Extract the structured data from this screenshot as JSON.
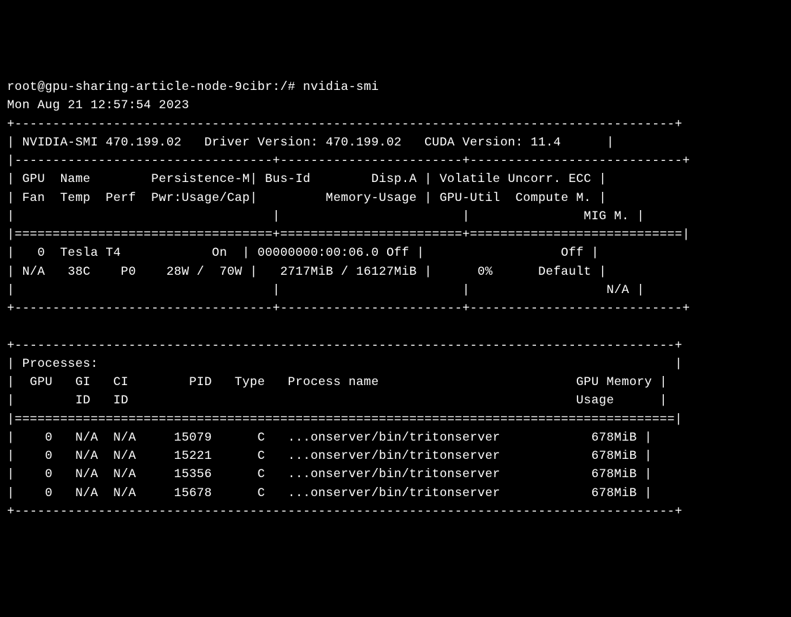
{
  "shell": {
    "prompt": "root@gpu-sharing-article-node-9cibr:/# ",
    "command": "nvidia-smi"
  },
  "header": {
    "timestamp": "Mon Aug 21 12:57:54 2023",
    "top_border": "+---------------------------------------------------------------------------------------+",
    "smi_line": "| NVIDIA-SMI 470.199.02   Driver Version: 470.199.02   CUDA Version: 11.4      |",
    "sep_line": "|----------------------------------+------------------------+----------------------------+",
    "hdr_line1": "| GPU  Name        Persistence-M| Bus-Id        Disp.A | Volatile Uncorr. ECC |",
    "hdr_line2": "| Fan  Temp  Perf  Pwr:Usage/Cap|         Memory-Usage | GPU-Util  Compute M. |",
    "hdr_line3": "|                                  |                        |               MIG M. |",
    "eq_line": "|==================================+========================+============================|",
    "gpu_line1": "|   0  Tesla T4            On  | 00000000:00:06.0 Off |                  Off |",
    "gpu_line2": "| N/A   38C    P0    28W /  70W |   2717MiB / 16127MiB |      0%      Default |",
    "gpu_line3": "|                                  |                        |                  N/A |",
    "bot_border": "+----------------------------------+------------------------+----------------------------+"
  },
  "procs": {
    "top_border": "+---------------------------------------------------------------------------------------+",
    "title": "| Processes:                                                                            |",
    "hdr_line1": "|  GPU   GI   CI        PID   Type   Process name                          GPU Memory |",
    "hdr_line2": "|        ID   ID                                                           Usage      |",
    "eq_line": "|=======================================================================================|",
    "rows": [
      "|    0   N/A  N/A     15079      C   ...onserver/bin/tritonserver            678MiB |",
      "|    0   N/A  N/A     15221      C   ...onserver/bin/tritonserver            678MiB |",
      "|    0   N/A  N/A     15356      C   ...onserver/bin/tritonserver            678MiB |",
      "|    0   N/A  N/A     15678      C   ...onserver/bin/tritonserver            678MiB |"
    ],
    "bot_border": "+---------------------------------------------------------------------------------------+"
  },
  "smi": {
    "version": "470.199.02",
    "driver_version": "470.199.02",
    "cuda_version": "11.4"
  },
  "gpu": {
    "index": 0,
    "name": "Tesla T4",
    "persistence_m": "On",
    "bus_id": "00000000:00:06.0",
    "disp_a": "Off",
    "ecc": "Off",
    "fan": "N/A",
    "temp": "38C",
    "perf": "P0",
    "pwr_usage": "28W",
    "pwr_cap": "70W",
    "mem_used": "2717MiB",
    "mem_total": "16127MiB",
    "gpu_util": "0%",
    "compute_m": "Default",
    "mig_m": "N/A"
  },
  "process_data": [
    {
      "gpu": 0,
      "gi_id": "N/A",
      "ci_id": "N/A",
      "pid": 15079,
      "type": "C",
      "name": "...onserver/bin/tritonserver",
      "mem": "678MiB"
    },
    {
      "gpu": 0,
      "gi_id": "N/A",
      "ci_id": "N/A",
      "pid": 15221,
      "type": "C",
      "name": "...onserver/bin/tritonserver",
      "mem": "678MiB"
    },
    {
      "gpu": 0,
      "gi_id": "N/A",
      "ci_id": "N/A",
      "pid": 15356,
      "type": "C",
      "name": "...onserver/bin/tritonserver",
      "mem": "678MiB"
    },
    {
      "gpu": 0,
      "gi_id": "N/A",
      "ci_id": "N/A",
      "pid": 15678,
      "type": "C",
      "name": "...onserver/bin/tritonserver",
      "mem": "678MiB"
    }
  ]
}
